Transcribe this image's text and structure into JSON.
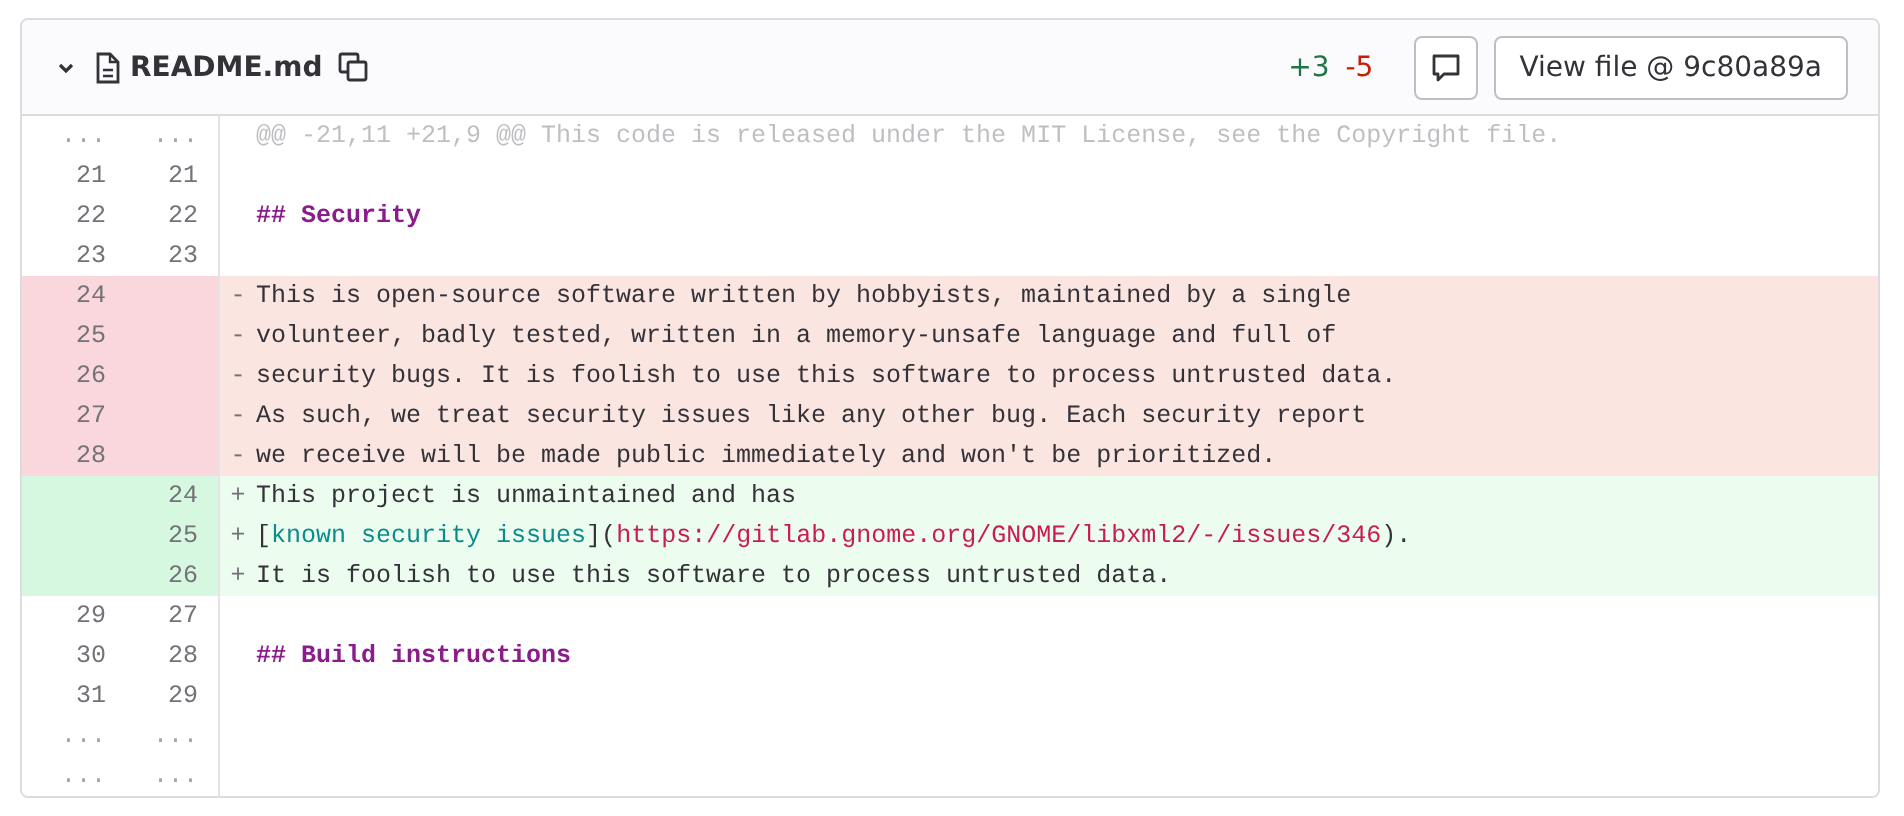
{
  "file": {
    "name": "README.md",
    "expanded": true,
    "additions": "+3",
    "deletions": "-5",
    "view_button": "View file @ 9c80a89a"
  },
  "lines": [
    {
      "kind": "hunk",
      "old": "...",
      "new": "...",
      "text": "@@ -21,11 +21,9 @@ This code is released under the MIT License, see the Copyright file."
    },
    {
      "kind": "context",
      "old": "21",
      "new": "21"
    },
    {
      "kind": "context",
      "old": "22",
      "new": "22",
      "segments": [
        {
          "kind": "heading",
          "text": "## Security"
        }
      ]
    },
    {
      "kind": "context",
      "old": "23",
      "new": "23"
    },
    {
      "kind": "removed",
      "old": "24",
      "marker": "-",
      "text": "This is open-source software written by hobbyists, maintained by a single"
    },
    {
      "kind": "removed",
      "old": "25",
      "marker": "-",
      "text": "volunteer, badly tested, written in a memory-unsafe language and full of"
    },
    {
      "kind": "removed",
      "old": "26",
      "marker": "-",
      "text": "security bugs. It is foolish to use this software to process untrusted data."
    },
    {
      "kind": "removed",
      "old": "27",
      "marker": "-",
      "text": "As such, we treat security issues like any other bug. Each security report"
    },
    {
      "kind": "removed",
      "old": "28",
      "marker": "-",
      "text": "we receive will be made public immediately and won't be prioritized."
    },
    {
      "kind": "added",
      "new": "24",
      "marker": "+",
      "text": "This project is unmaintained and has"
    },
    {
      "kind": "added",
      "new": "25",
      "marker": "+",
      "segments": [
        {
          "kind": "plain",
          "text": "["
        },
        {
          "kind": "link-text",
          "text": "known security issues"
        },
        {
          "kind": "plain",
          "text": "]("
        },
        {
          "kind": "url",
          "text": "https://gitlab.gnome.org/GNOME/libxml2/-/issues/346"
        },
        {
          "kind": "plain",
          "text": ")."
        }
      ]
    },
    {
      "kind": "added",
      "new": "26",
      "marker": "+",
      "text": "It is foolish to use this software to process untrusted data."
    },
    {
      "kind": "context",
      "old": "29",
      "new": "27"
    },
    {
      "kind": "context",
      "old": "30",
      "new": "28",
      "segments": [
        {
          "kind": "heading",
          "text": "## Build instructions"
        }
      ]
    },
    {
      "kind": "context",
      "old": "31",
      "new": "29"
    },
    {
      "kind": "fold",
      "old": "...",
      "new": "..."
    },
    {
      "kind": "fold",
      "old": "...",
      "new": "..."
    }
  ]
}
